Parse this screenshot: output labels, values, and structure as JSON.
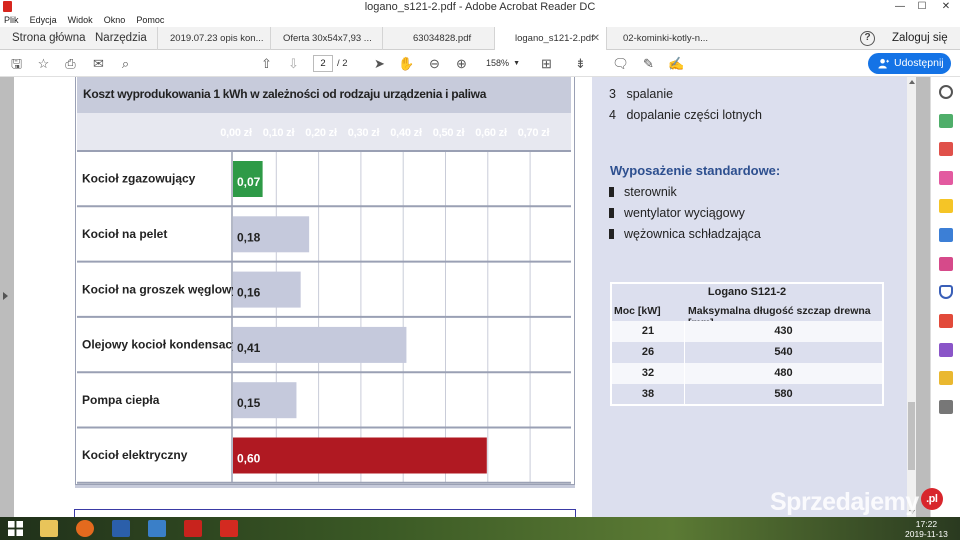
{
  "window": {
    "title": "logano_s121-2.pdf - Adobe Acrobat Reader DC"
  },
  "menu": [
    "Plik",
    "Edycja",
    "Widok",
    "Okno",
    "Pomoc"
  ],
  "nav": {
    "home": "Strona główna",
    "tools": "Narzędzia"
  },
  "tabs": [
    {
      "label": "2019.07.23 opis kon..."
    },
    {
      "label": "Oferta 30x54x7,93 ..."
    },
    {
      "label": "63034828.pdf"
    },
    {
      "label": "logano_s121-2.pdf",
      "active": true
    },
    {
      "label": "02-kominki-kotly-n..."
    }
  ],
  "signin": "Zaloguj się",
  "toolbar": {
    "page_current": "2",
    "page_total": "/ 2",
    "zoom": "158%",
    "share": "Udostępnij"
  },
  "chart_data": {
    "type": "bar",
    "orientation": "horizontal",
    "title": "Koszt wyprodukowania 1 kWh w zależności od rodzaju urządzenia i paliwa",
    "x_ticks": [
      "0,00 zł",
      "0,10 zł",
      "0,20 zł",
      "0,30 zł",
      "0,40 zł",
      "0,50 zł",
      "0,60 zł",
      "0,70 zł"
    ],
    "xlim": [
      0,
      0.7
    ],
    "categories": [
      "Kocioł zgazowujący",
      "Kocioł na pelet",
      "Kocioł na groszek węglowy",
      "Olejowy kocioł kondensacyjny",
      "Pompa ciepła",
      "Kocioł elektryczny"
    ],
    "values": [
      0.07,
      0.18,
      0.16,
      0.41,
      0.15,
      0.6
    ],
    "value_labels": [
      "0,07",
      "0,18",
      "0,16",
      "0,41",
      "0,15",
      "0,60"
    ],
    "bar_colors": [
      "#2e9a47",
      "#c5c9dc",
      "#c5c9dc",
      "#c5c9dc",
      "#c5c9dc",
      "#b01922"
    ],
    "grid": true
  },
  "right_panel": {
    "list": [
      {
        "num": "3",
        "text": "spalanie"
      },
      {
        "num": "4",
        "text": "dopalanie części lotnych"
      }
    ],
    "equipment_title": "Wyposażenie standardowe:",
    "equipment": [
      "sterownik",
      "wentylator wyciągowy",
      "wężownica schładzająca"
    ],
    "table": {
      "title": "Logano S121-2",
      "col1": "Moc [kW]",
      "col2": "Maksymalna długość szczap drewna [mm]",
      "rows": [
        [
          "21",
          "430"
        ],
        [
          "26",
          "540"
        ],
        [
          "32",
          "480"
        ],
        [
          "38",
          "580"
        ]
      ]
    }
  },
  "watermark": {
    "text": "Sprzedajemy",
    "badge": ".pl"
  },
  "clock": {
    "time": "17:22",
    "date": "2019-11-13"
  },
  "colors": {
    "accent": "#1473e6",
    "header_band": "#c7cbdb",
    "panel": "#dcdfee"
  }
}
